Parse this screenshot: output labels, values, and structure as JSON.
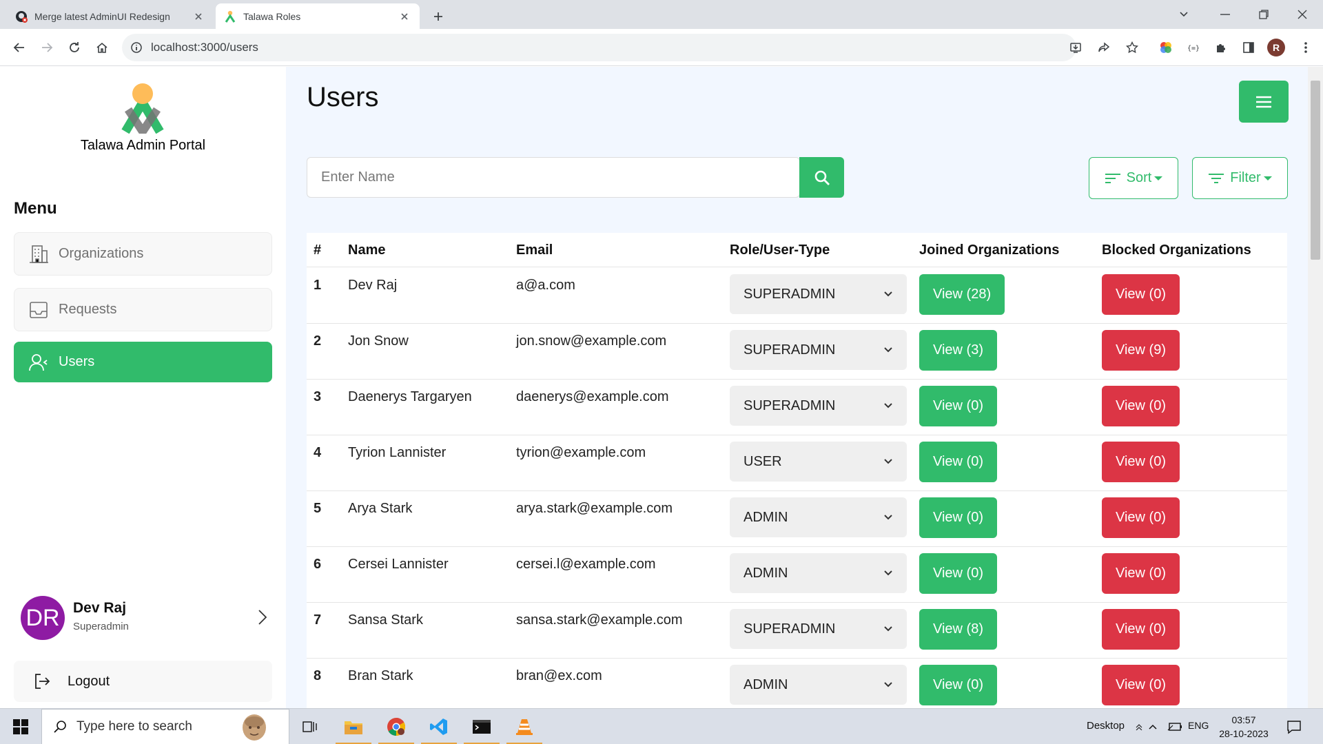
{
  "browser": {
    "tabs": [
      {
        "title": "Merge latest AdminUI Redesign",
        "active": false
      },
      {
        "title": "Talawa Roles",
        "active": true
      }
    ],
    "url": "localhost:3000/users",
    "profile_initial": "R"
  },
  "sidebar": {
    "portal_title": "Talawa Admin Portal",
    "menu_heading": "Menu",
    "items": [
      {
        "label": "Organizations",
        "icon": "building-icon",
        "active": false
      },
      {
        "label": "Requests",
        "icon": "inbox-icon",
        "active": false
      },
      {
        "label": "Users",
        "icon": "users-icon",
        "active": true
      }
    ],
    "profile": {
      "initials": "DR",
      "name": "Dev Raj",
      "role": "Superadmin"
    },
    "logout_label": "Logout"
  },
  "main": {
    "title": "Users",
    "search_placeholder": "Enter Name",
    "sort_label": "Sort",
    "filter_label": "Filter",
    "table": {
      "headers": [
        "#",
        "Name",
        "Email",
        "Role/User-Type",
        "Joined Organizations",
        "Blocked Organizations"
      ],
      "rows": [
        {
          "num": "1",
          "name": "Dev Raj",
          "email": "a@a.com",
          "role": "SUPERADMIN",
          "joined": "View (28)",
          "blocked": "View (0)"
        },
        {
          "num": "2",
          "name": "Jon Snow",
          "email": "jon.snow@example.com",
          "role": "SUPERADMIN",
          "joined": "View (3)",
          "blocked": "View (9)"
        },
        {
          "num": "3",
          "name": "Daenerys Targaryen",
          "email": "daenerys@example.com",
          "role": "SUPERADMIN",
          "joined": "View (0)",
          "blocked": "View (0)"
        },
        {
          "num": "4",
          "name": "Tyrion Lannister",
          "email": "tyrion@example.com",
          "role": "USER",
          "joined": "View (0)",
          "blocked": "View (0)"
        },
        {
          "num": "5",
          "name": "Arya Stark",
          "email": "arya.stark@example.com",
          "role": "ADMIN",
          "joined": "View (0)",
          "blocked": "View (0)"
        },
        {
          "num": "6",
          "name": "Cersei Lannister",
          "email": "cersei.l@example.com",
          "role": "ADMIN",
          "joined": "View (0)",
          "blocked": "View (0)"
        },
        {
          "num": "7",
          "name": "Sansa Stark",
          "email": "sansa.stark@example.com",
          "role": "SUPERADMIN",
          "joined": "View (8)",
          "blocked": "View (0)"
        },
        {
          "num": "8",
          "name": "Bran Stark",
          "email": "bran@ex.com",
          "role": "ADMIN",
          "joined": "View (0)",
          "blocked": "View (0)"
        }
      ]
    }
  },
  "taskbar": {
    "search_placeholder": "Type here to search",
    "desktop_label": "Desktop",
    "language": "ENG",
    "time": "03:57",
    "date": "28-10-2023"
  },
  "colors": {
    "accent": "#31bb6b",
    "danger": "#dc3545",
    "avatar": "#8e1ba3"
  }
}
